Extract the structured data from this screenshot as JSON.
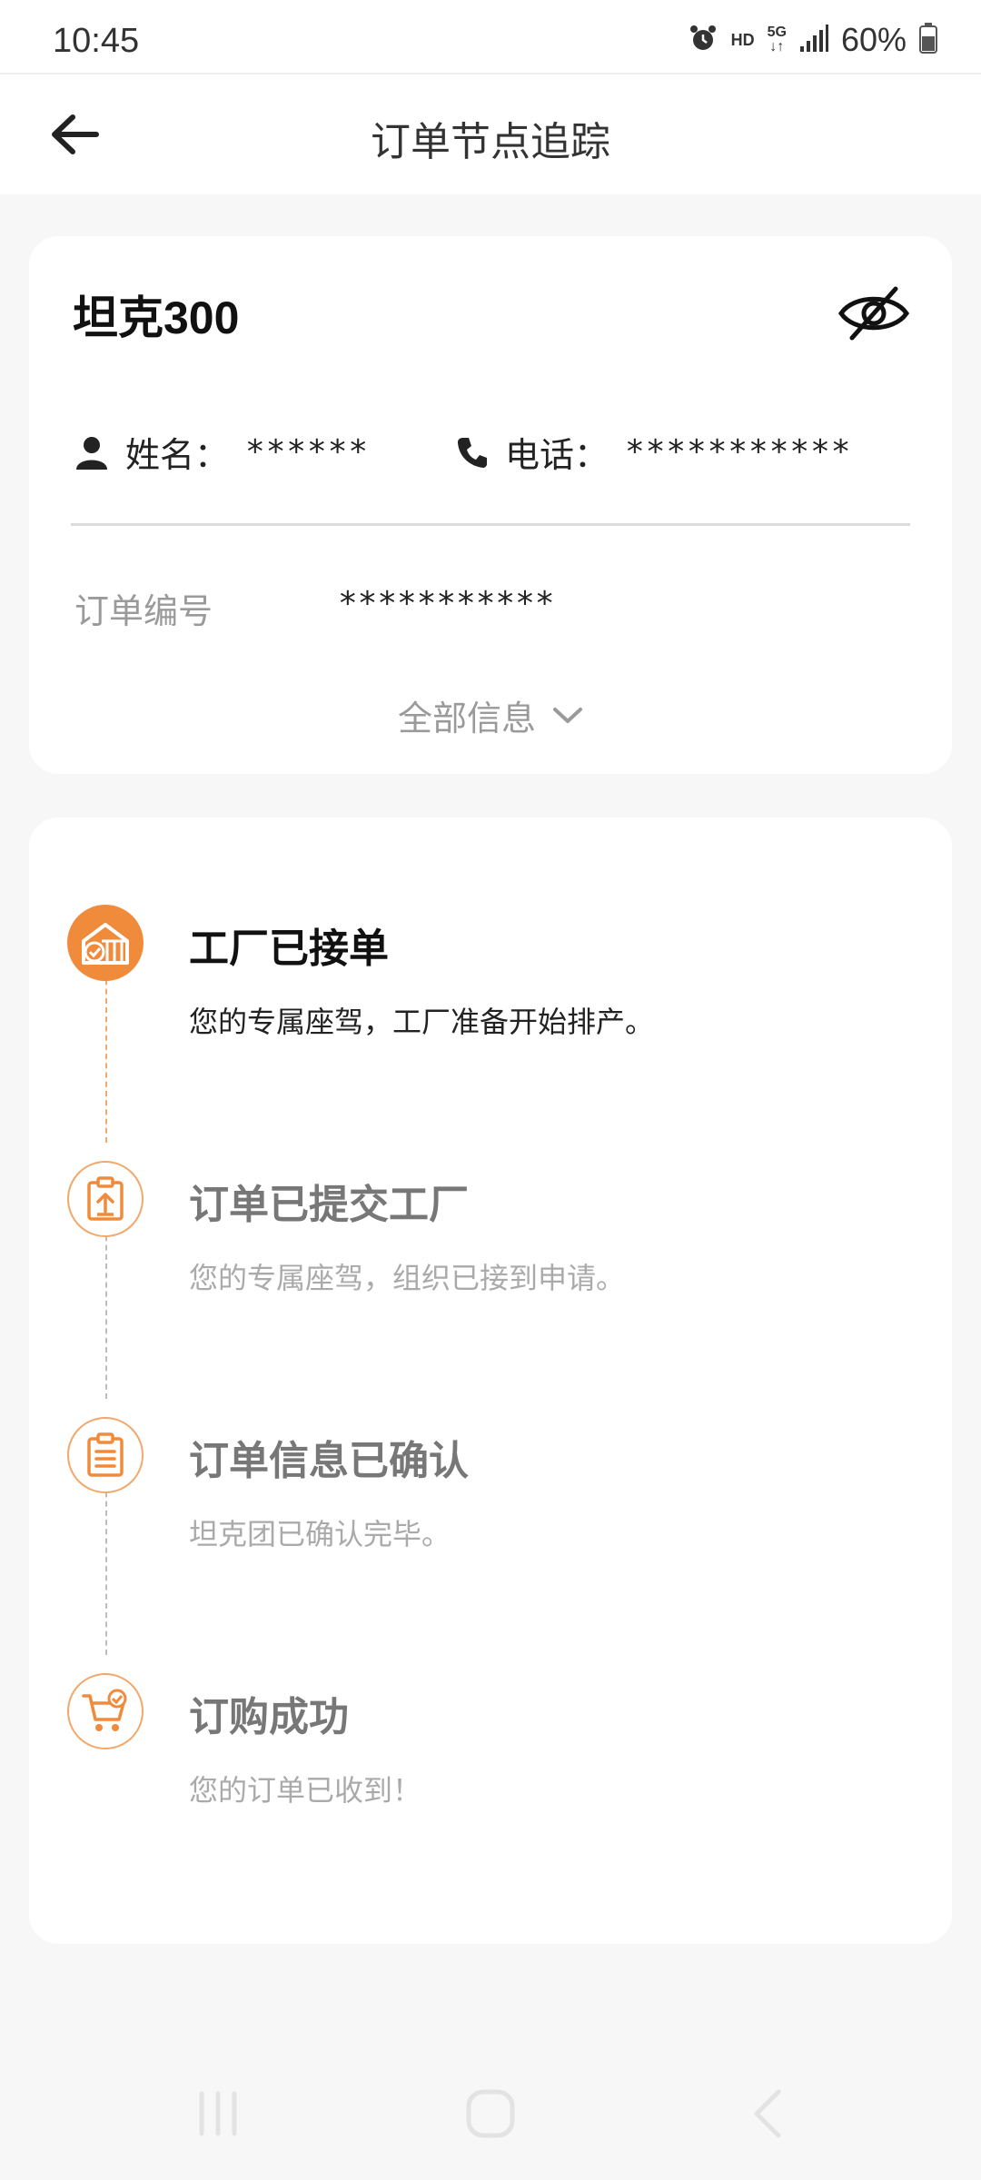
{
  "status_bar": {
    "time": "10:45",
    "hd": "HD",
    "network": "5G",
    "battery": "60%",
    "icons": [
      "alarm-icon",
      "signal-icon",
      "battery-icon"
    ]
  },
  "header": {
    "title": "订单节点追踪",
    "back_icon": "arrow-left-icon"
  },
  "info_card": {
    "model": "坦克300",
    "visibility_icon": "eye-off-icon",
    "name_label": "姓名：",
    "name_value": "******",
    "phone_label": "电话：",
    "phone_value": "***********",
    "order_label": "订单编号",
    "order_value": "***********",
    "expand_label": "全部信息"
  },
  "timeline": {
    "steps": [
      {
        "title": "工厂已接单",
        "desc": "您的专属座驾，工厂准备开始排产。",
        "state": "active",
        "icon": "factory-check-icon"
      },
      {
        "title": "订单已提交工厂",
        "desc": "您的专属座驾，组织已接到申请。",
        "state": "inactive",
        "icon": "clipboard-upload-icon"
      },
      {
        "title": "订单信息已确认",
        "desc": "坦克团已确认完毕。",
        "state": "inactive",
        "icon": "clipboard-list-icon"
      },
      {
        "title": "订购成功",
        "desc": "您的订单已收到！",
        "state": "inactive",
        "icon": "cart-check-icon"
      }
    ]
  },
  "colors": {
    "accent": "#f08b3c",
    "accent_light": "#f2a86a",
    "background": "#f7f7f7",
    "card": "#ffffff"
  }
}
